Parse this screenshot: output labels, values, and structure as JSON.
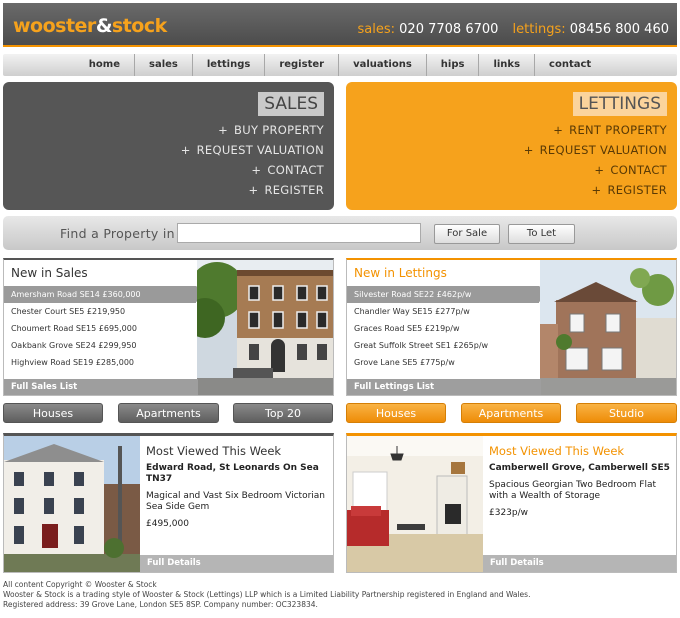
{
  "header": {
    "logo_part1": "wooster",
    "logo_amp": "&",
    "logo_part2": "stock",
    "sales_label": "sales:",
    "sales_phone": "020 7708 6700",
    "lettings_label": "lettings:",
    "lettings_phone": "08456 800 460"
  },
  "nav": [
    "home",
    "sales",
    "lettings",
    "register",
    "valuations",
    "hips",
    "links",
    "contact"
  ],
  "sales_panel": {
    "title": "SALES",
    "links": [
      "BUY PROPERTY",
      "REQUEST VALUATION",
      "CONTACT",
      "REGISTER"
    ]
  },
  "lettings_panel": {
    "title": "LETTINGS",
    "links": [
      "RENT PROPERTY",
      "REQUEST VALUATION",
      "CONTACT",
      "REGISTER"
    ]
  },
  "search": {
    "label": "Find a Property in",
    "placeholder": "",
    "for_sale": "For Sale",
    "to_let": "To Let"
  },
  "new_sales": {
    "title": "New in Sales",
    "items": [
      "Amersham Road SE14 £360,000",
      "Chester Court SE5 £219,950",
      "Choumert Road SE15 £695,000",
      "Oakbank Grove SE24 £299,950",
      "Highview Road SE19 £285,000"
    ],
    "footer": "Full Sales List"
  },
  "new_lettings": {
    "title": "New in Lettings",
    "items": [
      "Silvester Road SE22 £462p/w",
      "Chandler Way SE15 £277p/w",
      "Graces Road SE5 £219p/w",
      "Great Suffolk Street SE1 £265p/w",
      "Grove Lane SE5 £775p/w"
    ],
    "footer": "Full Lettings List"
  },
  "sales_categories": [
    "Houses",
    "Apartments",
    "Top 20"
  ],
  "lettings_categories": [
    "Houses",
    "Apartments",
    "Studio"
  ],
  "most_viewed_sales": {
    "heading": "Most Viewed This Week",
    "address": "Edward Road, St Leonards On Sea TN37",
    "description": "Magical and Vast Six Bedroom Victorian Sea Side Gem",
    "price": "£495,000",
    "footer": "Full Details"
  },
  "most_viewed_lettings": {
    "heading": "Most Viewed This Week",
    "address": "Camberwell Grove, Camberwell SE5",
    "description": "Spacious Georgian Two Bedroom Flat with a Wealth of Storage",
    "price": "£323p/w",
    "footer": "Full Details"
  },
  "footer": {
    "line1": "All content Copyright © Wooster & Stock",
    "line2": "Wooster & Stock is a trading style of Wooster & Stock (Lettings) LLP which is a Limited Liability Partnership registered in England and Wales. Registered address: 39 Grove Lane, London SE5 8SP. Company number: OC323834."
  },
  "colors": {
    "brand_orange": "#f39200",
    "dark_gray": "#565656"
  }
}
